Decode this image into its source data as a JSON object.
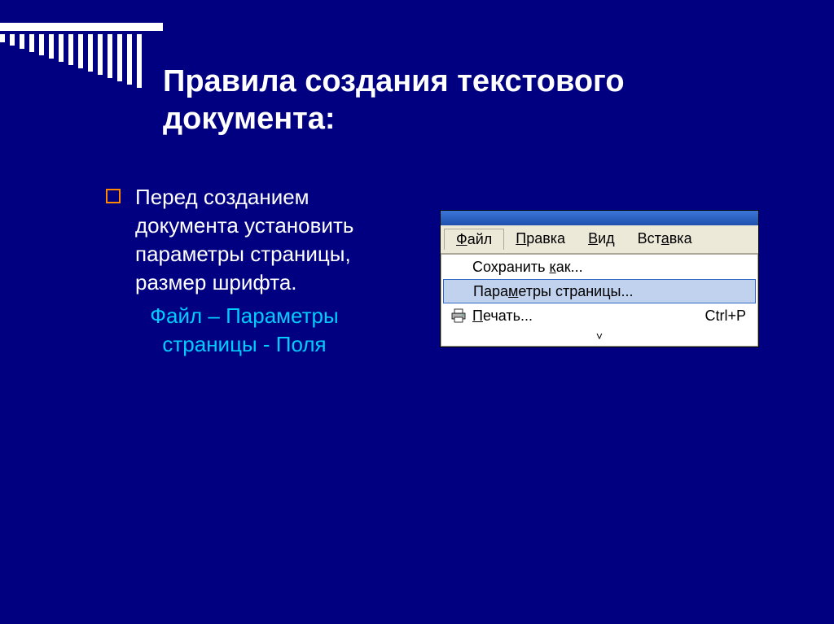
{
  "title": "Правила создания текстового документа:",
  "bullet": {
    "text": "Перед созданием документа установить параметры страницы, размер шрифта."
  },
  "highlight": "Файл – Параметры страницы - Поля",
  "menubar": {
    "file": {
      "pre": "",
      "u": "Ф",
      "post": "айл"
    },
    "edit": {
      "pre": "",
      "u": "П",
      "post": "равка"
    },
    "view": {
      "pre": "",
      "u": "В",
      "post": "ид"
    },
    "insert": {
      "pre": "Вст",
      "u": "а",
      "post": "вка"
    }
  },
  "dropdown": {
    "saveas": {
      "pre": "Сохранить ",
      "u": "к",
      "post": "ак..."
    },
    "pagesetup": {
      "pre": "Пара",
      "u": "м",
      "post": "етры страницы..."
    },
    "print": {
      "pre": "",
      "u": "П",
      "post": "ечать...",
      "shortcut": "Ctrl+P"
    }
  },
  "chevron": "˅"
}
